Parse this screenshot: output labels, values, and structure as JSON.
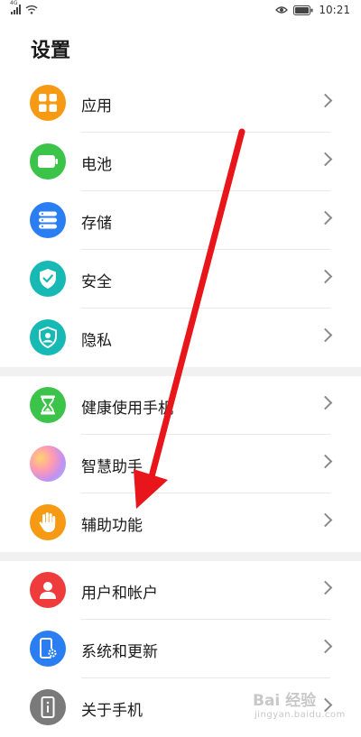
{
  "status_bar": {
    "signal_label": "4G",
    "time": "10:21"
  },
  "page": {
    "title": "设置"
  },
  "groups": [
    {
      "items": [
        {
          "label": "应用",
          "icon": "apps-icon",
          "color": "#f59a12"
        },
        {
          "label": "电池",
          "icon": "battery-icon",
          "color": "#3cc44a"
        },
        {
          "label": "存储",
          "icon": "storage-icon",
          "color": "#2a7ef2"
        },
        {
          "label": "安全",
          "icon": "security-icon",
          "color": "#17b9b4"
        },
        {
          "label": "隐私",
          "icon": "privacy-icon",
          "color": "#17b9b4"
        }
      ]
    },
    {
      "items": [
        {
          "label": "健康使用手机",
          "icon": "hourglass-icon",
          "color": "#3cc44a"
        },
        {
          "label": "智慧助手",
          "icon": "assistant-icon",
          "color": "#c590f0"
        },
        {
          "label": "辅助功能",
          "icon": "hand-icon",
          "color": "#f59a12"
        }
      ]
    },
    {
      "items": [
        {
          "label": "用户和帐户",
          "icon": "user-icon",
          "color": "#ee3b3b"
        },
        {
          "label": "系统和更新",
          "icon": "system-update-icon",
          "color": "#2a7ef2"
        },
        {
          "label": "关于手机",
          "icon": "phone-info-icon",
          "color": "#7a7a7a"
        }
      ]
    }
  ],
  "annotation": {
    "color": "#e8161a"
  },
  "watermark": {
    "line1": "Bai 经验",
    "line2": "jingyan.baidu.com"
  }
}
